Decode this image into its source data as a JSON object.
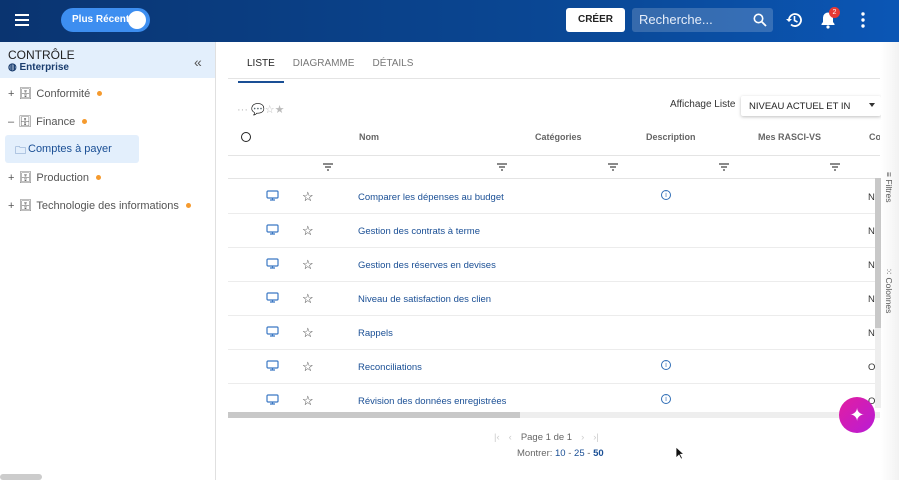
{
  "header": {
    "toggle_label": "Plus Récent",
    "create_label": "CRÉER",
    "search_placeholder": "Recherche...",
    "notification_count": "2"
  },
  "sidebar": {
    "title": "CONTRÔLE",
    "subtitle": "Enterprise",
    "items": [
      {
        "label": "Conformité",
        "expander": "+"
      },
      {
        "label": "Finance",
        "expander": "–"
      },
      {
        "label": "Production",
        "expander": "+"
      },
      {
        "label": "Technologie des informations",
        "expander": "+"
      }
    ],
    "selected": "Comptes à payer"
  },
  "tabs": [
    "LISTE",
    "DIAGRAMME",
    "DÉTAILS"
  ],
  "list_view": {
    "label": "Affichage Liste",
    "value": "NIVEAU ACTUEL ET IN"
  },
  "columns": [
    "Nom",
    "Catégories",
    "Description",
    "Mes RASCI-VS",
    "Co"
  ],
  "rows": [
    {
      "name": "Comparer les dépenses au budget",
      "info": true,
      "co": "N"
    },
    {
      "name": "Gestion des contrats à terme",
      "info": false,
      "co": "N"
    },
    {
      "name": "Gestion des réserves en devises",
      "info": false,
      "co": "N"
    },
    {
      "name": "Niveau de satisfaction des clien",
      "info": false,
      "co": "N"
    },
    {
      "name": "Rappels",
      "info": false,
      "co": "N"
    },
    {
      "name": "Reconciliations",
      "info": true,
      "co": "O"
    },
    {
      "name": "Révision des données enregistrées",
      "info": true,
      "co": "O"
    }
  ],
  "side_panels": {
    "filters": "Filtres",
    "columns": "Colonnes"
  },
  "pagination": {
    "page_label": "Page",
    "page": "1",
    "of_label": "de",
    "total": "1",
    "show_label": "Montrer:",
    "sizes": [
      "10",
      "25",
      "50"
    ],
    "selected_size": "50"
  }
}
